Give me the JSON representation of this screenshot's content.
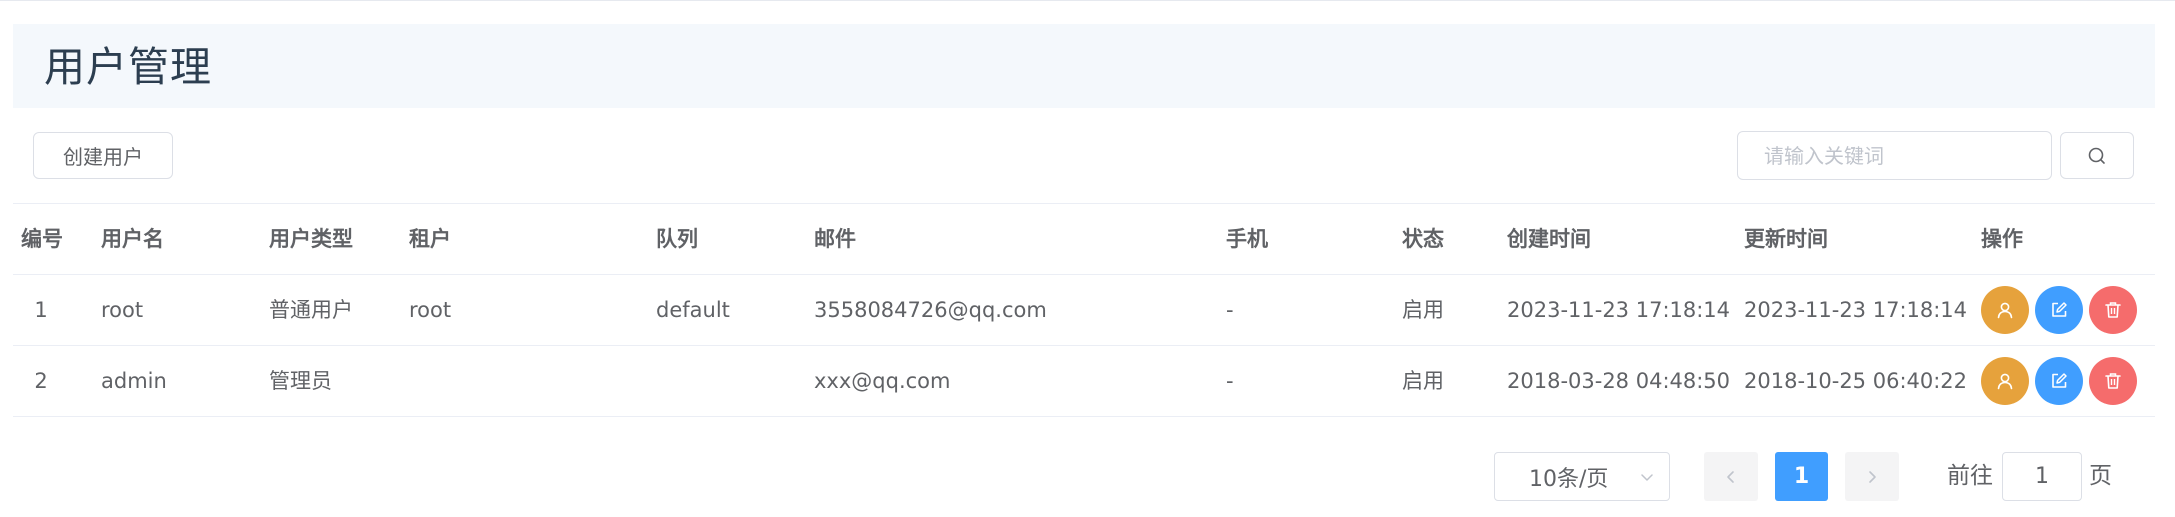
{
  "page": {
    "title": "用户管理"
  },
  "toolbar": {
    "create_label": "创建用户",
    "search_placeholder": "请输入关键词",
    "search_value": ""
  },
  "table": {
    "headers": {
      "id": "编号",
      "name": "用户名",
      "type": "用户类型",
      "tenant": "租户",
      "queue": "队列",
      "mail": "邮件",
      "phone": "手机",
      "status": "状态",
      "created": "创建时间",
      "updated": "更新时间",
      "ops": "操作"
    },
    "rows": [
      {
        "id": "1",
        "name": "root",
        "type": "普通用户",
        "tenant": "root",
        "queue": "default",
        "mail": "3558084726@qq.com",
        "phone": "-",
        "status": "启用",
        "created": "2023-11-23 17:18:14",
        "updated": "2023-11-23 17:18:14"
      },
      {
        "id": "2",
        "name": "admin",
        "type": "管理员",
        "tenant": "",
        "queue": "",
        "mail": "xxx@qq.com",
        "phone": "-",
        "status": "启用",
        "created": "2018-03-28 04:48:50",
        "updated": "2018-10-25 06:40:22"
      }
    ],
    "action_icons": [
      "user-icon",
      "edit-icon",
      "delete-icon"
    ]
  },
  "pagination": {
    "page_size_label": "10条/页",
    "current_page": "1",
    "goto_prefix": "前往",
    "goto_value": "1",
    "goto_suffix": "页"
  },
  "colors": {
    "primary": "#409eff",
    "warning": "#e6a23c",
    "danger": "#f56c6c",
    "title_bg": "#f4f8fc",
    "title_text": "#2c3e50"
  }
}
